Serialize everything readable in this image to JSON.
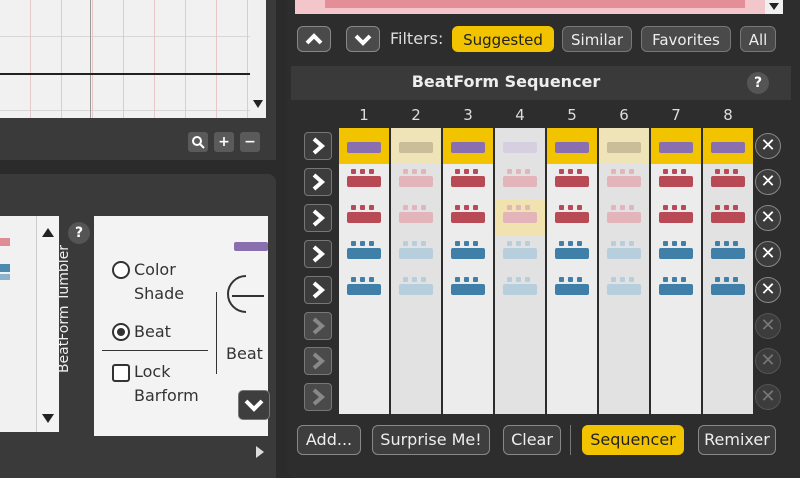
{
  "filters": {
    "label": "Filters:",
    "buttons": [
      {
        "label": "Suggested",
        "active": true
      },
      {
        "label": "Similar",
        "active": false
      },
      {
        "label": "Favorites",
        "active": false
      },
      {
        "label": "All",
        "active": false
      }
    ]
  },
  "sequencer": {
    "title": "BeatForm Sequencer",
    "help_icon": "question-circle-icon",
    "columns": [
      "1",
      "2",
      "3",
      "4",
      "5",
      "6",
      "7",
      "8"
    ],
    "highlight_color": "#f2c400",
    "add_label": "Add...",
    "surprise_label": "Surprise Me!",
    "clear_label": "Clear",
    "sequencer_label": "Sequencer",
    "remixer_label": "Remixer"
  },
  "tumbler": {
    "title": "BeatForm Tumbler",
    "options": [
      {
        "label_line1": "Color",
        "label_line2": "Shade",
        "type": "radio",
        "selected": false
      },
      {
        "label_line1": "Beat",
        "label_line2": "",
        "type": "radio",
        "selected": true
      },
      {
        "label_line1": "Lock",
        "label_line2": "Barform",
        "type": "checkbox",
        "checked": false
      }
    ],
    "beat_label": "Beat"
  },
  "colors": {
    "accent": "#f2c400",
    "purple": "#8a6fb0",
    "red": "#b84a55",
    "blue": "#3f7fa8"
  }
}
